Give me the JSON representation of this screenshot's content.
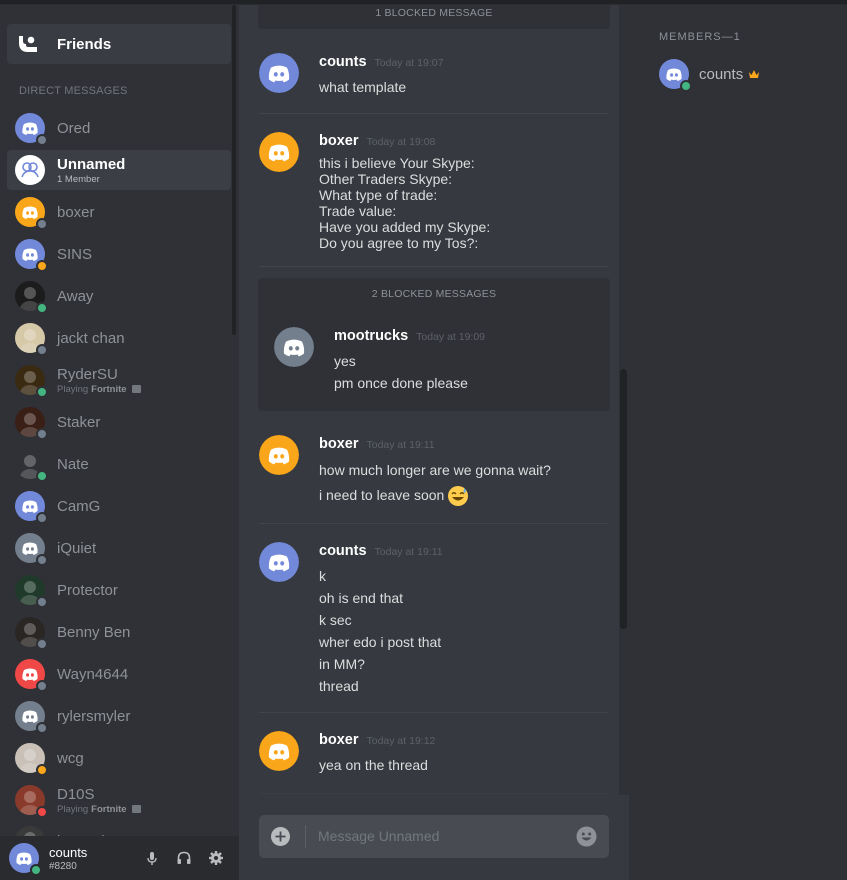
{
  "sidebar": {
    "friends_label": "Friends",
    "dm_header": "DIRECT MESSAGES",
    "dms": [
      {
        "name": "Ored",
        "avatar": "discord-logo",
        "color": "#7289da",
        "status": "off"
      },
      {
        "name": "Unnamed",
        "sub": "1 Member",
        "avatar": "group-icon",
        "color": "#ffffff",
        "status": "none",
        "active": true
      },
      {
        "name": "boxer",
        "avatar": "discord-logo",
        "color": "#faa61a",
        "status": "off"
      },
      {
        "name": "SINS",
        "avatar": "discord-logo",
        "color": "#7289da",
        "status": "idle"
      },
      {
        "name": "Away",
        "avatar": "photo",
        "color": "#1c1c1c",
        "status": "on"
      },
      {
        "name": "jackt chan",
        "avatar": "photo",
        "color": "#d6c9a8",
        "status": "off"
      },
      {
        "name": "RyderSU",
        "sub_prefix": "Playing",
        "sub_game": "Fortnite",
        "avatar": "photo",
        "color": "#3a2a12",
        "status": "on"
      },
      {
        "name": "Staker",
        "avatar": "photo",
        "color": "#3a1f16",
        "status": "off"
      },
      {
        "name": "Nate",
        "avatar": "photo",
        "color": "#2f3136",
        "status": "on"
      },
      {
        "name": "CamG",
        "avatar": "discord-logo",
        "color": "#7289da",
        "status": "off"
      },
      {
        "name": "iQuiet",
        "avatar": "discord-logo",
        "color": "#747f8d",
        "status": "off"
      },
      {
        "name": "Protector",
        "avatar": "photo",
        "color": "#1f3a2a",
        "status": "off"
      },
      {
        "name": "Benny Ben",
        "avatar": "photo",
        "color": "#2a2624",
        "status": "off"
      },
      {
        "name": "Wayn4644",
        "avatar": "discord-logo",
        "color": "#f04747",
        "status": "off"
      },
      {
        "name": "rylersmyler",
        "avatar": "discord-logo",
        "color": "#747f8d",
        "status": "off"
      },
      {
        "name": "wcg",
        "avatar": "photo",
        "color": "#c9c0b8",
        "status": "idle"
      },
      {
        "name": "D10S",
        "sub_prefix": "Playing",
        "sub_game": "Fortnite",
        "avatar": "photo",
        "color": "#8a3a2a",
        "status": "dnd"
      },
      {
        "name": "iovanni",
        "avatar": "photo",
        "color": "#3a3a3a",
        "status": "off"
      }
    ]
  },
  "user": {
    "name": "counts",
    "tag": "#8280"
  },
  "chat": {
    "blocked_top": "1 BLOCKED MESSAGE",
    "blocked_group_label": "2 BLOCKED MESSAGES",
    "messages": [
      {
        "author": "counts",
        "time": "Today at 19:07",
        "lines": [
          "what template"
        ]
      },
      {
        "author": "boxer",
        "time": "Today at 19:08",
        "lines": [
          "this i believe Your Skype:",
          "Other Traders Skype:",
          "What type of trade:",
          "Trade value:",
          "Have you added my Skype:",
          "Do you agree to my Tos?:"
        ]
      },
      {
        "author": "mootrucks",
        "time": "Today at 19:09",
        "lines": [
          "yes",
          "pm once done please"
        ]
      },
      {
        "author": "boxer",
        "time": "Today at 19:11",
        "lines": [
          "how much longer are we gonna wait?",
          "i need to leave soon"
        ]
      },
      {
        "author": "counts",
        "time": "Today at 19:11",
        "lines": [
          "k",
          "oh is end that",
          "k sec",
          "wher edo i post that",
          "in MM?",
          "thread"
        ]
      },
      {
        "author": "boxer",
        "time": "Today at 19:12",
        "lines": [
          "yea on the thread"
        ]
      }
    ],
    "input_placeholder": "Message Unnamed"
  },
  "members": {
    "header": "MEMBERS—1",
    "list": [
      {
        "name": "counts",
        "owner_icon": "crown-icon"
      }
    ]
  },
  "colors": {
    "blurple": "#7289da",
    "orange": "#faa61a",
    "grey": "#747f8d",
    "online": "#43b581"
  }
}
